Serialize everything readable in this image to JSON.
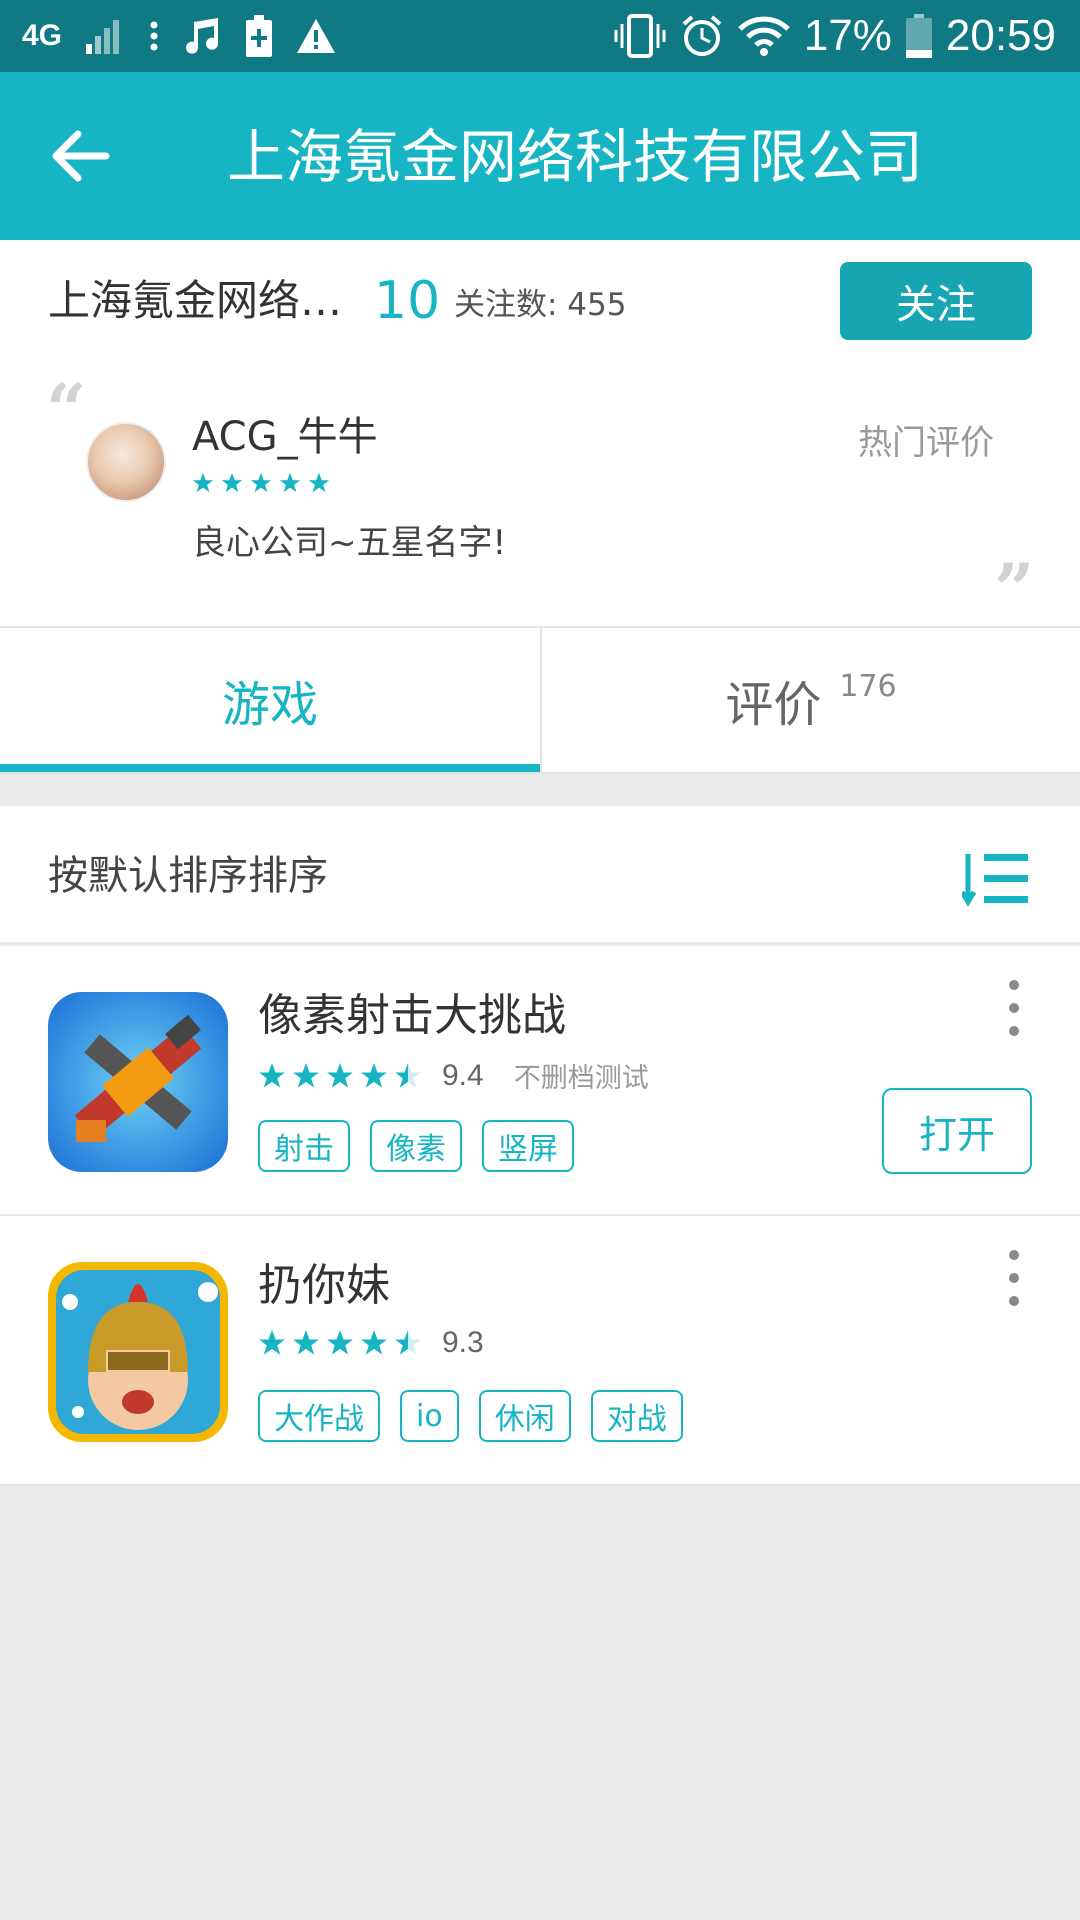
{
  "status_bar": {
    "network": "4G",
    "battery": "17%",
    "time": "20:59"
  },
  "app_bar": {
    "title": "上海氪金网络科技有限公司"
  },
  "company": {
    "name": "上海氪金网络…",
    "game_count": "10",
    "followers_label": "关注数: 455",
    "follow_label": "关注"
  },
  "review": {
    "user": "ACG_牛牛",
    "rating": 5,
    "tag": "热门评价",
    "text": "良心公司~五星名字!"
  },
  "tabs": [
    {
      "label": "游戏",
      "count": ""
    },
    {
      "label": "评价",
      "count": "176"
    }
  ],
  "sort": {
    "label": "按默认排序排序"
  },
  "games": [
    {
      "name": "像素射击大挑战",
      "rating": 4.5,
      "score": "9.4",
      "status": "不删档测试",
      "tags": [
        "射击",
        "像素",
        "竖屏"
      ],
      "action": "打开"
    },
    {
      "name": "扔你妹",
      "rating": 4.5,
      "score": "9.3",
      "status": "",
      "tags": [
        "大作战",
        "io",
        "休闲",
        "对战"
      ],
      "action": ""
    }
  ],
  "colors": {
    "accent": "#17b5c4",
    "status_bar": "#0f7a83",
    "follow_button": "#17a5b2"
  }
}
